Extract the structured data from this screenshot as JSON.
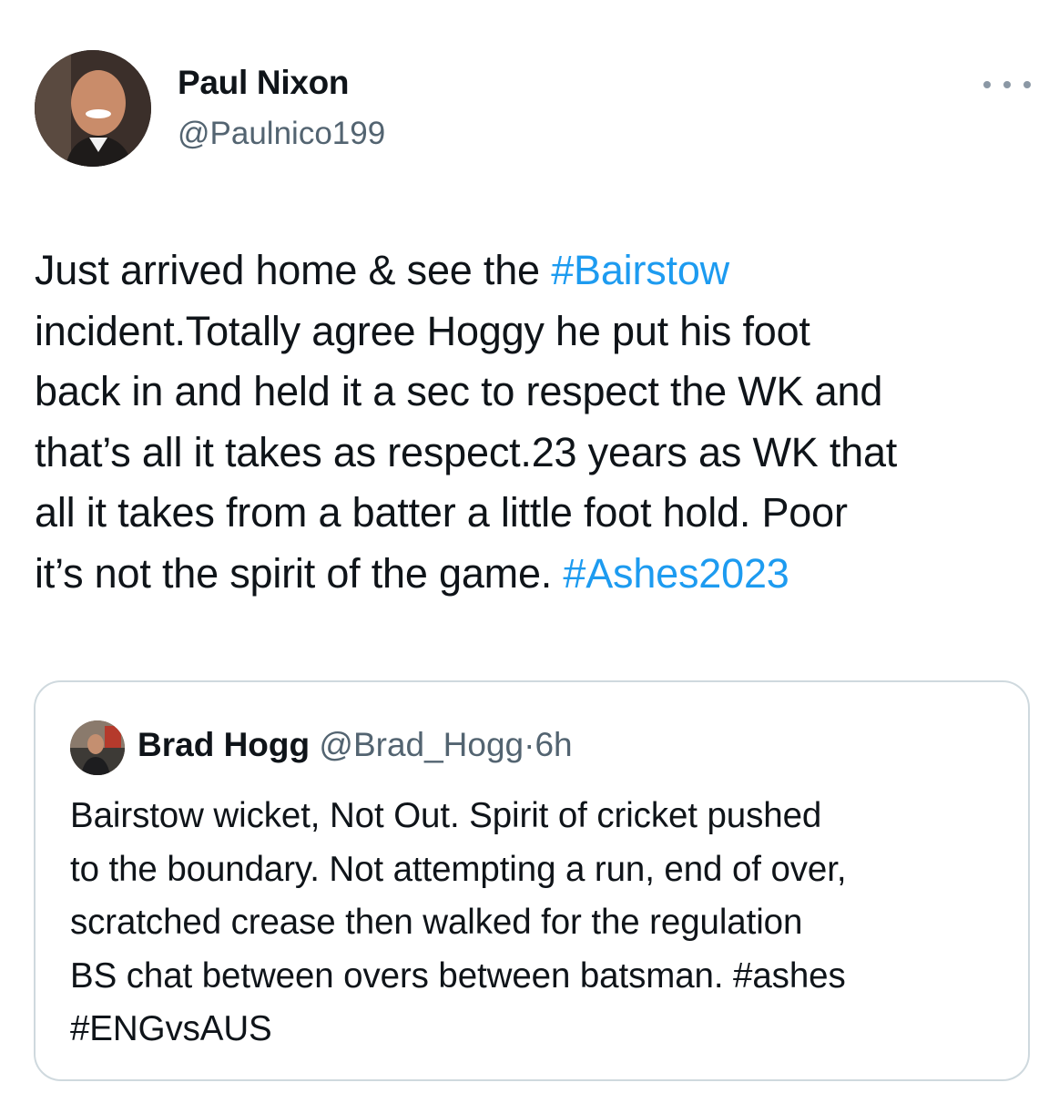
{
  "author": {
    "name": "Paul Nixon",
    "handle": "@Paulnico199",
    "avatar_icon": "profile-photo-avatar"
  },
  "more_icon": "ellipsis-icon",
  "tweet": {
    "lines": [
      [
        "Just arrived home & see the ",
        "#Bairstow"
      ],
      [
        "incident.Totally agree Hoggy he put his foot"
      ],
      [
        "back in and held it a sec to respect the WK and"
      ],
      [
        "that’s all it takes as respect.23 years as WK that"
      ],
      [
        "all it takes from a batter a little foot hold.  Poor"
      ],
      [
        "it’s not the spirit of the game. ",
        "#Ashes2023"
      ]
    ]
  },
  "quote": {
    "name": "Brad Hogg",
    "handle": "@Brad_Hogg",
    "separator": "·",
    "time": "6h",
    "avatar_icon": "profile-photo-avatar",
    "lines": [
      [
        "Bairstow wicket, Not Out. Spirit of cricket pushed"
      ],
      [
        "to the boundary. Not attempting a run, end of over,"
      ],
      [
        "scratched crease then walked for the regulation"
      ],
      [
        "BS chat between overs between batsman.  ",
        "#ashes"
      ],
      [
        "#ENGvsAUS"
      ]
    ]
  },
  "colors": {
    "text": "#0f1419",
    "secondary": "#536471",
    "link": "#1d9bf0",
    "border": "#cfd9de"
  }
}
